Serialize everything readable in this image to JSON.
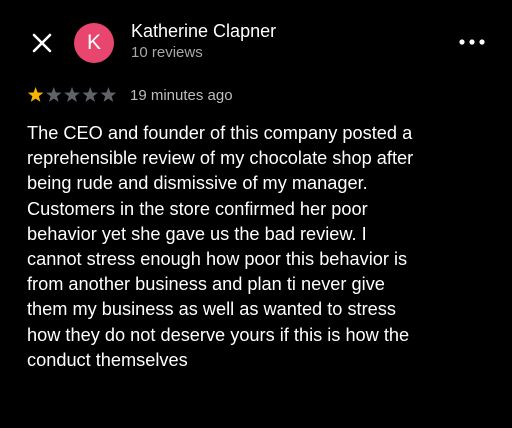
{
  "header": {
    "close_icon": "close-icon",
    "avatar_letter": "K",
    "avatar_color": "#e8466f",
    "user_name": "Katherine Clapner",
    "review_count": "10 reviews",
    "more_icon": "more-options-icon"
  },
  "review": {
    "rating": 1,
    "rating_max": 5,
    "star_filled_color": "#f7b500",
    "star_empty_color": "#5f6368",
    "time_ago": "19 minutes ago",
    "text": "The CEO and founder of this company posted a\nreprehensible review of my chocolate shop after\nbeing rude and dismissive of my manager.\nCustomers in the store confirmed her poor\nbehavior yet she gave us the bad review.  I\ncannot stress enough how poor this behavior is\nfrom another business and plan ti never give\nthem my business as well as wanted to stress\nhow they do not deserve yours if this is how the\nconduct themselves"
  }
}
